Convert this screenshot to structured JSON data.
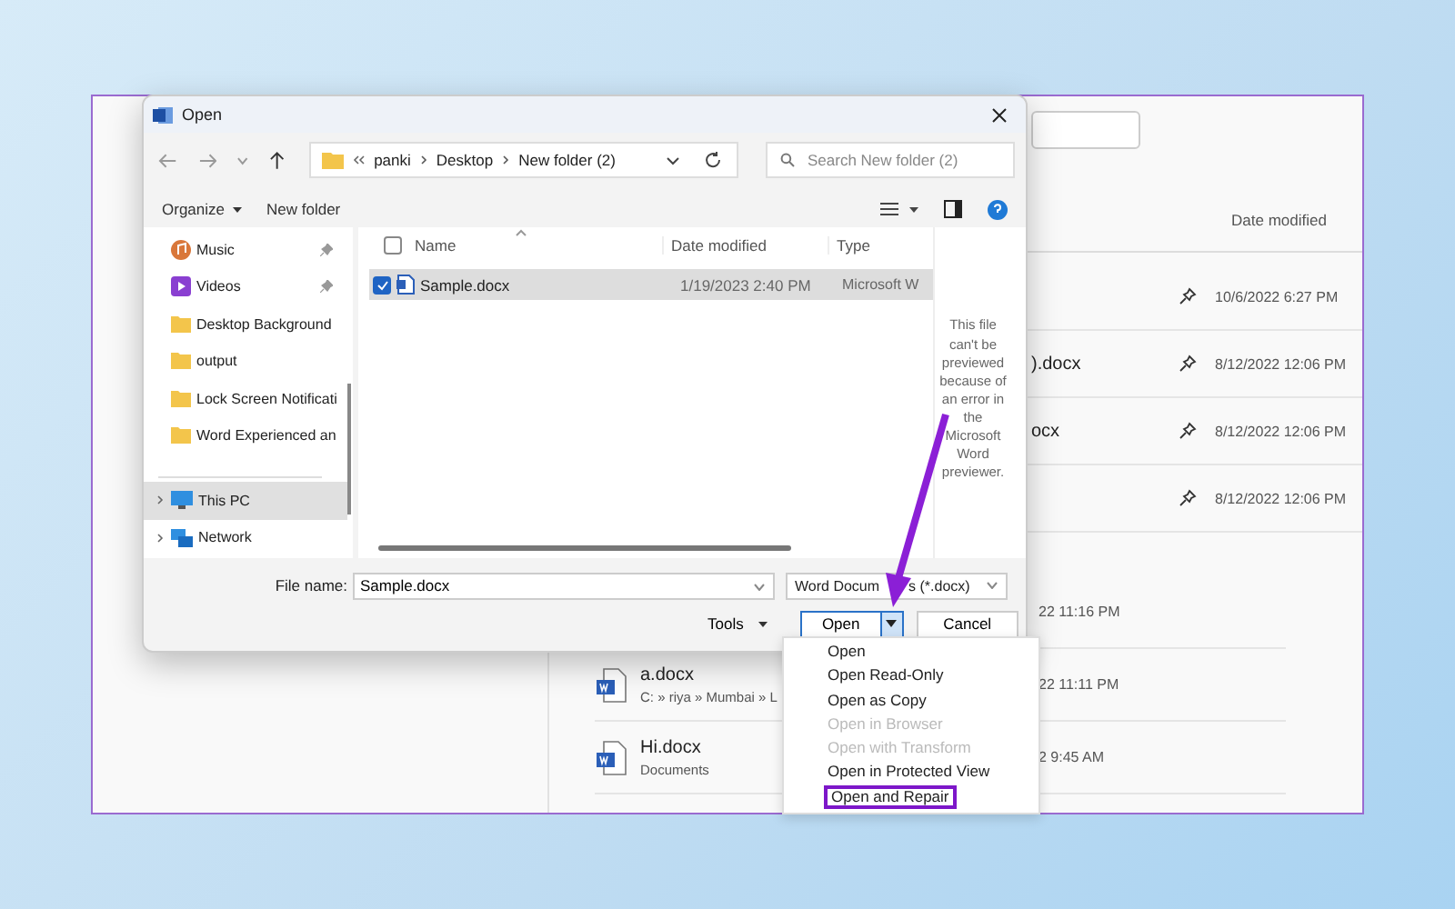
{
  "backstage": {
    "column_header": "Date modified",
    "pinned_rows": [
      {
        "date": "10/6/2022 6:27 PM"
      },
      {
        "name": ").docx",
        "date": "8/12/2022 12:06 PM"
      },
      {
        "name": "ocx",
        "date": "8/12/2022 12:06 PM"
      },
      {
        "date": "8/12/2022 12:06 PM"
      }
    ],
    "recent_rows": [
      {
        "date": "22 11:16 PM"
      },
      {
        "name": "a.docx",
        "path": "C: » riya » Mumbai » L",
        "date": "22 11:11 PM"
      },
      {
        "name": "Hi.docx",
        "path": "Documents",
        "date": "2 9:45 AM"
      }
    ]
  },
  "dialog": {
    "title": "Open",
    "breadcrumb": [
      "panki",
      "Desktop",
      "New folder (2)"
    ],
    "search_placeholder": "Search New folder (2)",
    "toolbar": [
      "Organize",
      "New folder"
    ],
    "sidebar": [
      {
        "label": "Music",
        "kind": "music",
        "pinned": true,
        "expandable": false,
        "selected": false
      },
      {
        "label": "Videos",
        "kind": "videos",
        "pinned": true,
        "expandable": false,
        "selected": false
      },
      {
        "label": "Desktop Background",
        "kind": "folder",
        "pinned": false,
        "expandable": false,
        "selected": false
      },
      {
        "label": "output",
        "kind": "folder",
        "pinned": false,
        "expandable": false,
        "selected": false
      },
      {
        "label": "Lock Screen Notificati",
        "kind": "folder",
        "pinned": false,
        "expandable": false,
        "selected": false
      },
      {
        "label": "Word Experienced an",
        "kind": "folder",
        "pinned": false,
        "expandable": false,
        "selected": false
      },
      {
        "label": "This PC",
        "kind": "pc",
        "pinned": false,
        "expandable": true,
        "selected": true
      },
      {
        "label": "Network",
        "kind": "network",
        "pinned": false,
        "expandable": true,
        "selected": false
      }
    ],
    "select_all_checked": false,
    "columns": [
      "Name",
      "Date modified",
      "Type"
    ],
    "files": [
      {
        "name": "Sample.docx",
        "date": "1/19/2023 2:40 PM",
        "type": "Microsoft W",
        "selected": true,
        "checked": true
      }
    ],
    "preview_message": "This file can't be previewed because of an error in the Microsoft Word previewer.",
    "file_name_label": "File name:",
    "file_name": "Sample.docx",
    "file_type": [
      "Word Docum",
      "s (*.docx)"
    ],
    "buttons": {
      "tools": "Tools",
      "open": "Open",
      "cancel": "Cancel"
    },
    "open_menu": [
      {
        "label": "Open",
        "disabled": false,
        "highlighted": false
      },
      {
        "label": "Open Read-Only",
        "disabled": false,
        "highlighted": false
      },
      {
        "label": "Open as Copy",
        "disabled": false,
        "highlighted": false
      },
      {
        "label": "Open in Browser",
        "disabled": true,
        "highlighted": false
      },
      {
        "label": "Open with Transform",
        "disabled": true,
        "highlighted": false
      },
      {
        "label": "Open in Protected View",
        "disabled": false,
        "highlighted": false
      },
      {
        "label": "Open and Repair",
        "disabled": false,
        "highlighted": true
      }
    ]
  }
}
